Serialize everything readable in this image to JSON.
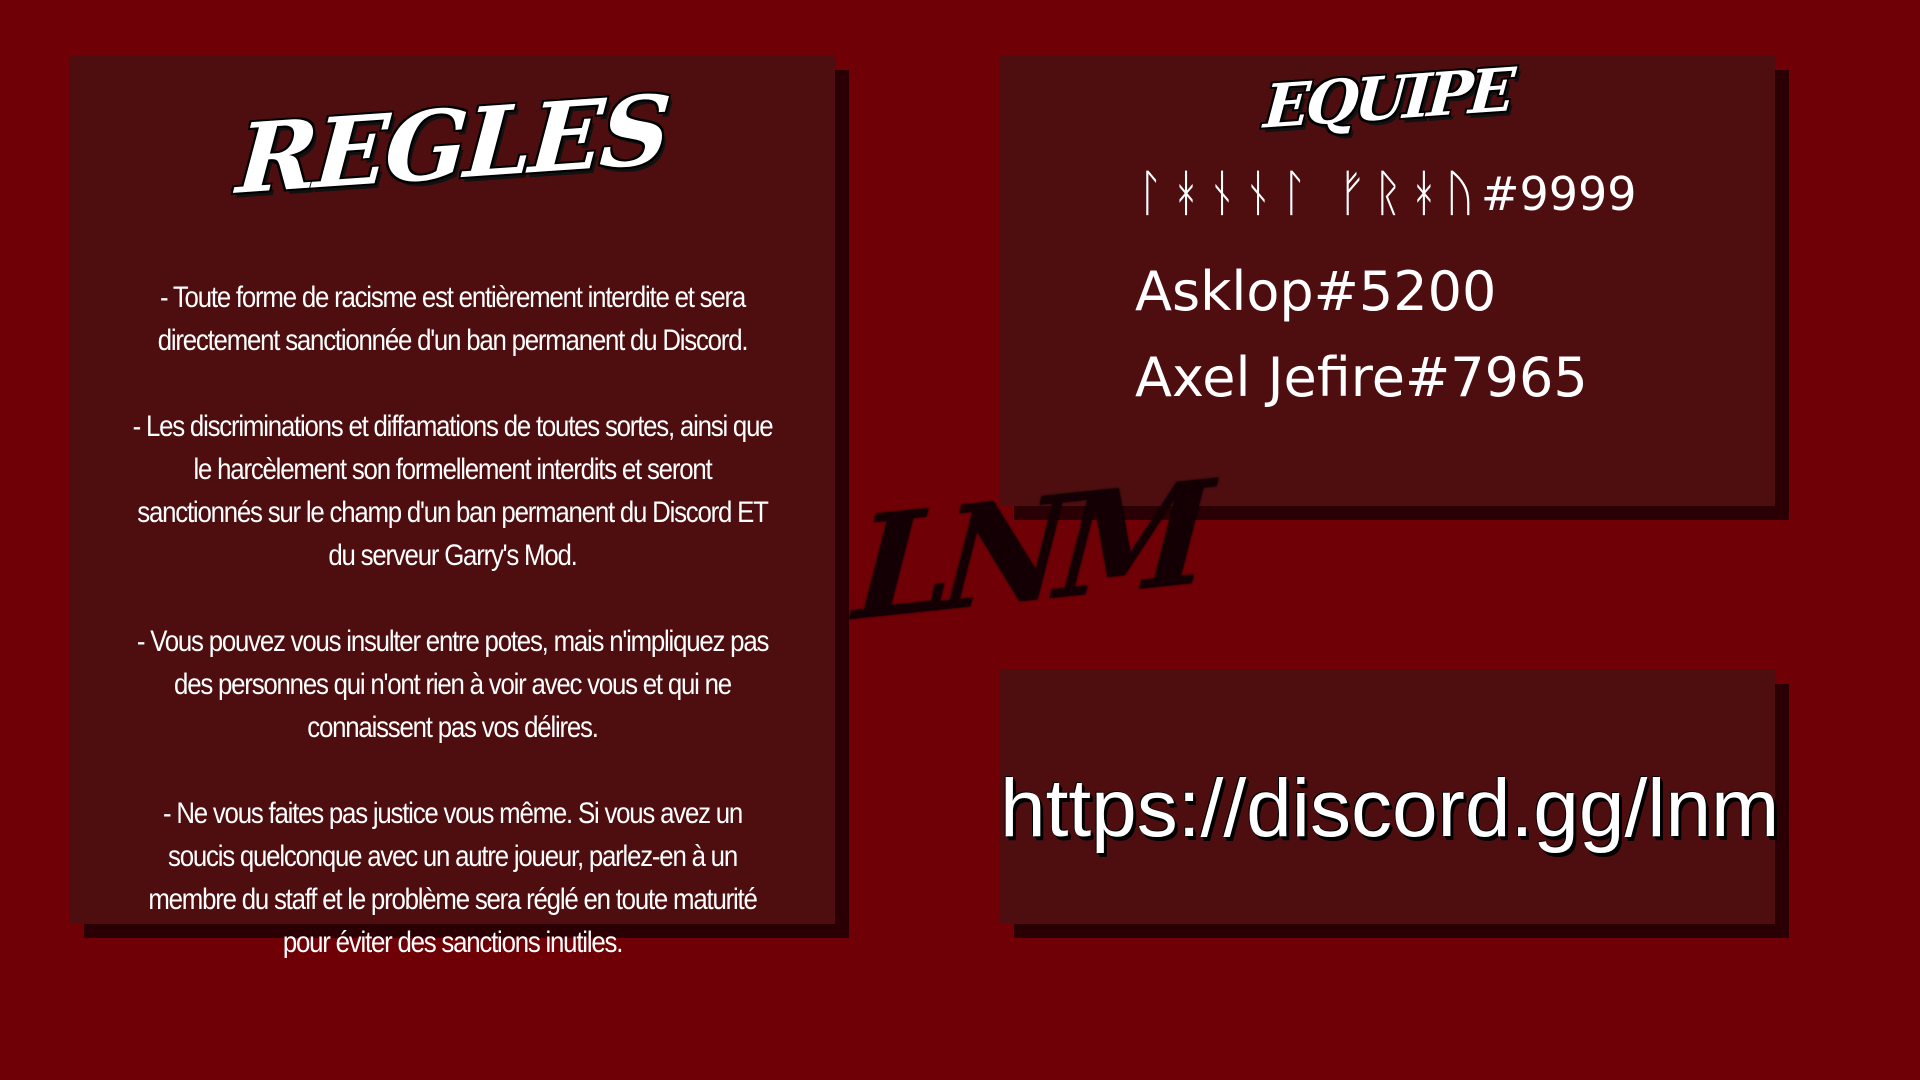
{
  "rules": {
    "title": "REGLES",
    "items": [
      "- Toute forme de racisme est entièrement interdite et sera directement sanctionnée d'un ban permanent du Discord.",
      "- Les discriminations et diffamations de toutes sortes, ainsi que le harcèlement son formellement interdits et seront sanctionnés sur le champ d'un ban permanent du Discord ET du serveur Garry's Mod.",
      "- Vous pouvez vous insulter entre potes, mais n'impliquez pas des personnes qui n'ont rien à voir avec vous et qui ne connaissent pas vos délires.",
      "- Ne vous faites pas justice vous même. Si vous avez un soucis quelconque avec un autre joueur, parlez-en à un membre du staff et le problème sera réglé en toute maturité pour éviter des sanctions inutiles."
    ]
  },
  "team": {
    "title": "EQUIPE",
    "members": [
      {
        "name": "ᛚᚼᚾᚾᛚ ᚠᚱᚼᚢ",
        "tag": "#9999"
      },
      {
        "name": "Asklop",
        "tag": "#5200"
      },
      {
        "name": "Axel Jefire",
        "tag": "#7965"
      }
    ]
  },
  "invite": {
    "link": "https://discord.gg/lnm"
  },
  "logo": {
    "text": "LNM"
  },
  "colors": {
    "background": "#6e0006",
    "panel": "#4e0e10",
    "shadow": "#2a0004",
    "text": "#ffffff"
  }
}
